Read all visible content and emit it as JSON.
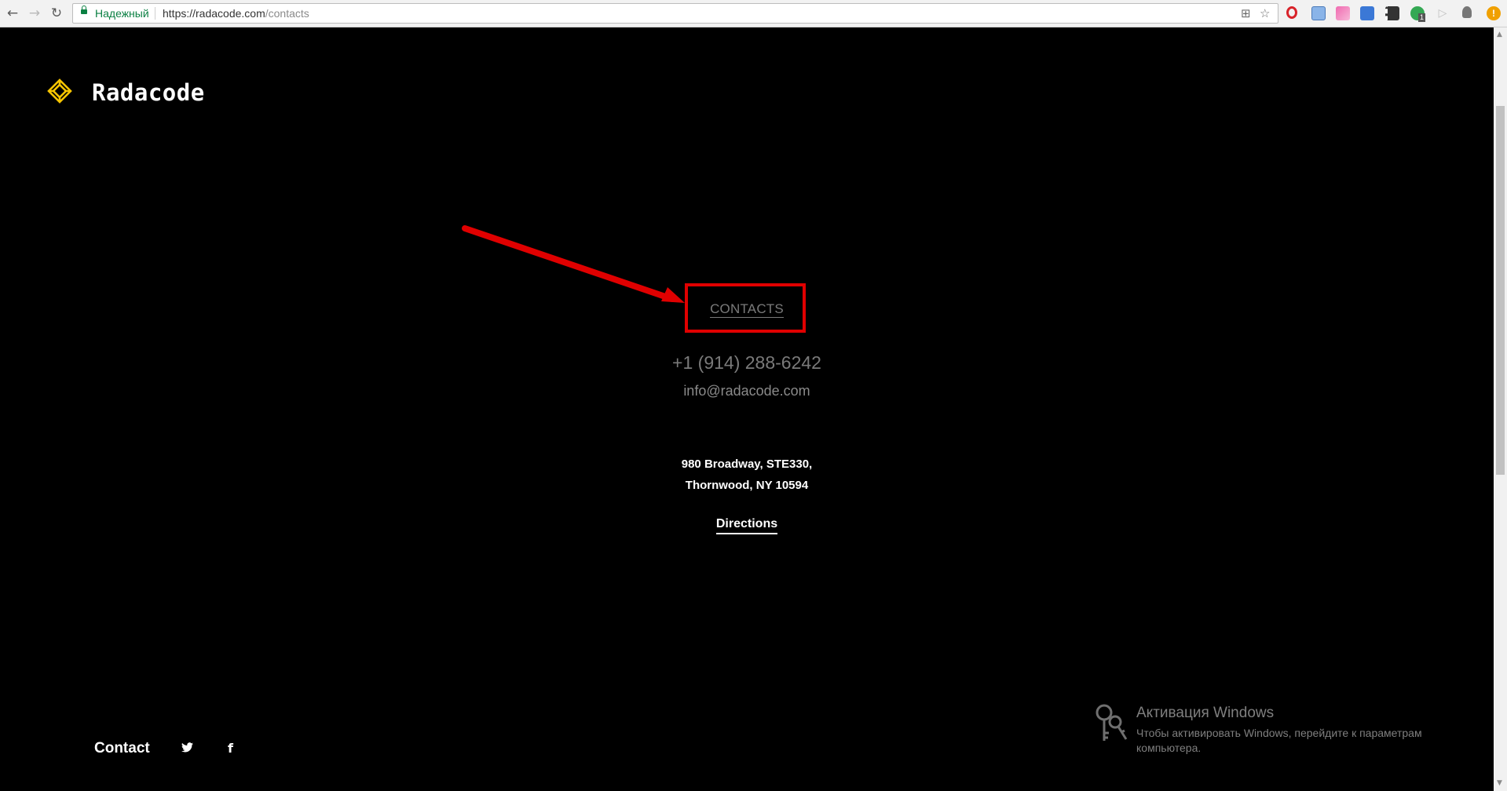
{
  "browser": {
    "secure_label": "Надежный",
    "url_host": "https://radacode.com",
    "url_path": "/contacts",
    "icons": [
      "back-arrow-icon",
      "forward-arrow-icon",
      "reload-icon",
      "lock-icon",
      "translate-icon",
      "star-icon",
      "opera-icon",
      "extension-icon",
      "extension-icon",
      "translate-extension-icon",
      "film-icon",
      "shield-check-icon",
      "play-icon",
      "lightbulb-icon",
      "warning-icon"
    ],
    "extension_badge": "1"
  },
  "header": {
    "brand_name": "Radacode",
    "logo_color": "#f5c400"
  },
  "contacts": {
    "link_label": "CONTACTS",
    "phone": "+1 (914) 288-6242",
    "email": "info@radacode.com",
    "address_line1": "980 Broadway, STE330,",
    "address_line2": "Thornwood, NY 10594",
    "directions_label": "Directions"
  },
  "annotation": {
    "color": "#e00000"
  },
  "footer": {
    "contact_label": "Contact",
    "twitter_glyph": "🐦",
    "facebook_glyph": "f"
  },
  "windows_watermark": {
    "title": "Активация Windows",
    "subtitle": "Чтобы активировать Windows, перейдите к параметрам компьютера."
  }
}
